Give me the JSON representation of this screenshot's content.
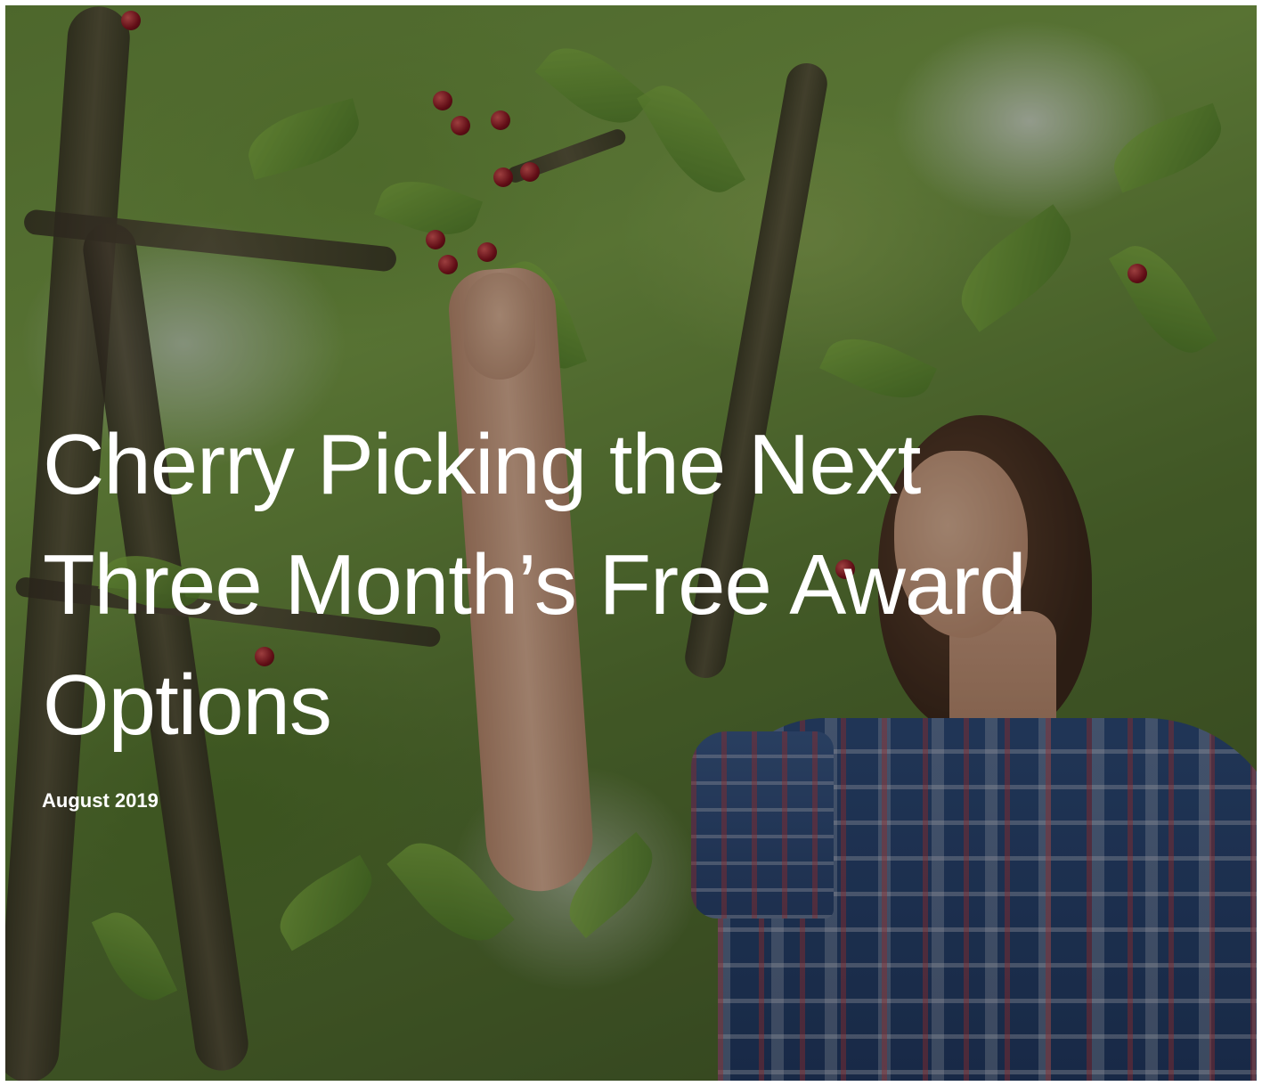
{
  "hero": {
    "title_lines": [
      "Cherry Picking the Next",
      "Three Month’s Free Award",
      "Options"
    ],
    "date": "August 2019",
    "colors": {
      "overlay": "rgba(0,0,0,0.30)",
      "text": "#ffffff",
      "foliage": "#6f9440",
      "shirt": "#2f4d7c",
      "cherry": "#8b1420"
    }
  }
}
